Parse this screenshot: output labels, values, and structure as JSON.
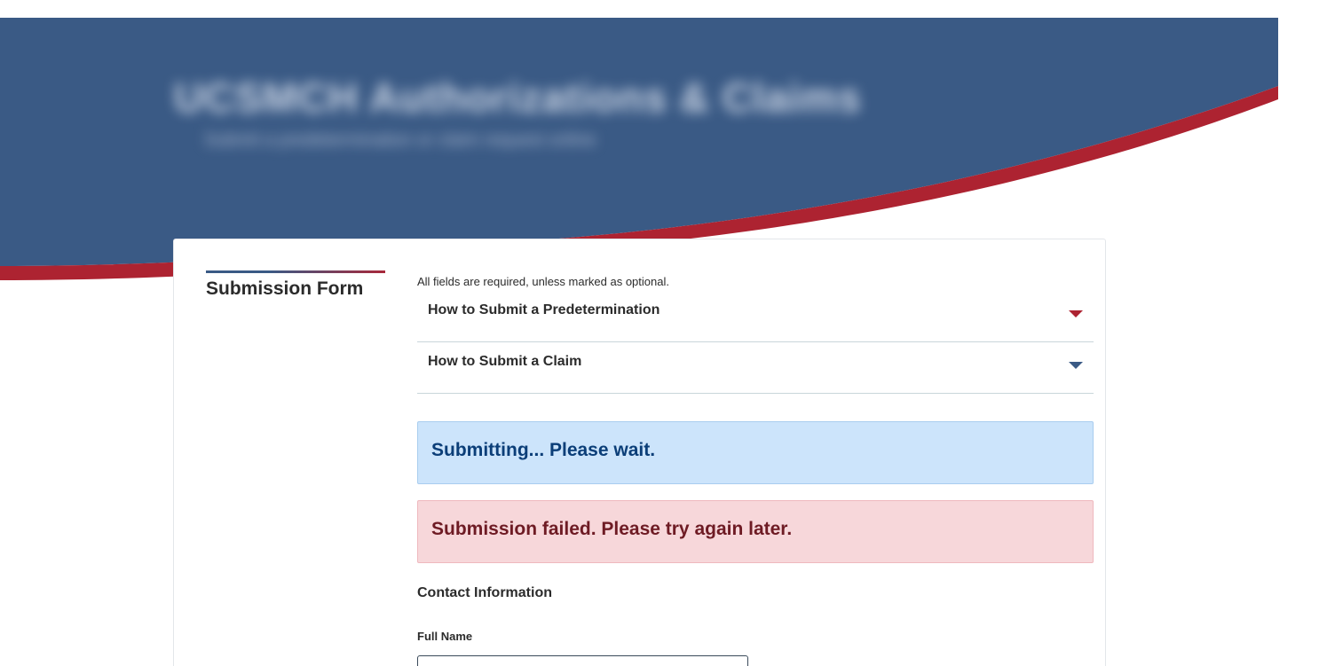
{
  "colors": {
    "banner_blue": "#3a5a85",
    "banner_red": "#ad2331",
    "info_bg": "#cce4fb",
    "info_text": "#0b3e78",
    "error_bg": "#f7d7da",
    "error_text": "#6e1b24"
  },
  "banner": {
    "title": "UCSMCH Authorizations & Claims",
    "subtitle": "Submit a predetermination or claim request online"
  },
  "form": {
    "section_title": "Submission Form",
    "required_note": "All fields are required, unless marked as optional.",
    "accordions": [
      {
        "label": "How to Submit a Predetermination",
        "icon": "chevron-down-icon",
        "color": "#ad2331"
      },
      {
        "label": "How to Submit a Claim",
        "icon": "chevron-down-icon",
        "color": "#3a5a85"
      }
    ],
    "alerts": {
      "info": "Submitting... Please wait.",
      "error": "Submission failed. Please try again later."
    },
    "contact": {
      "heading": "Contact Information",
      "full_name_label": "Full Name",
      "full_name_value": ""
    }
  }
}
